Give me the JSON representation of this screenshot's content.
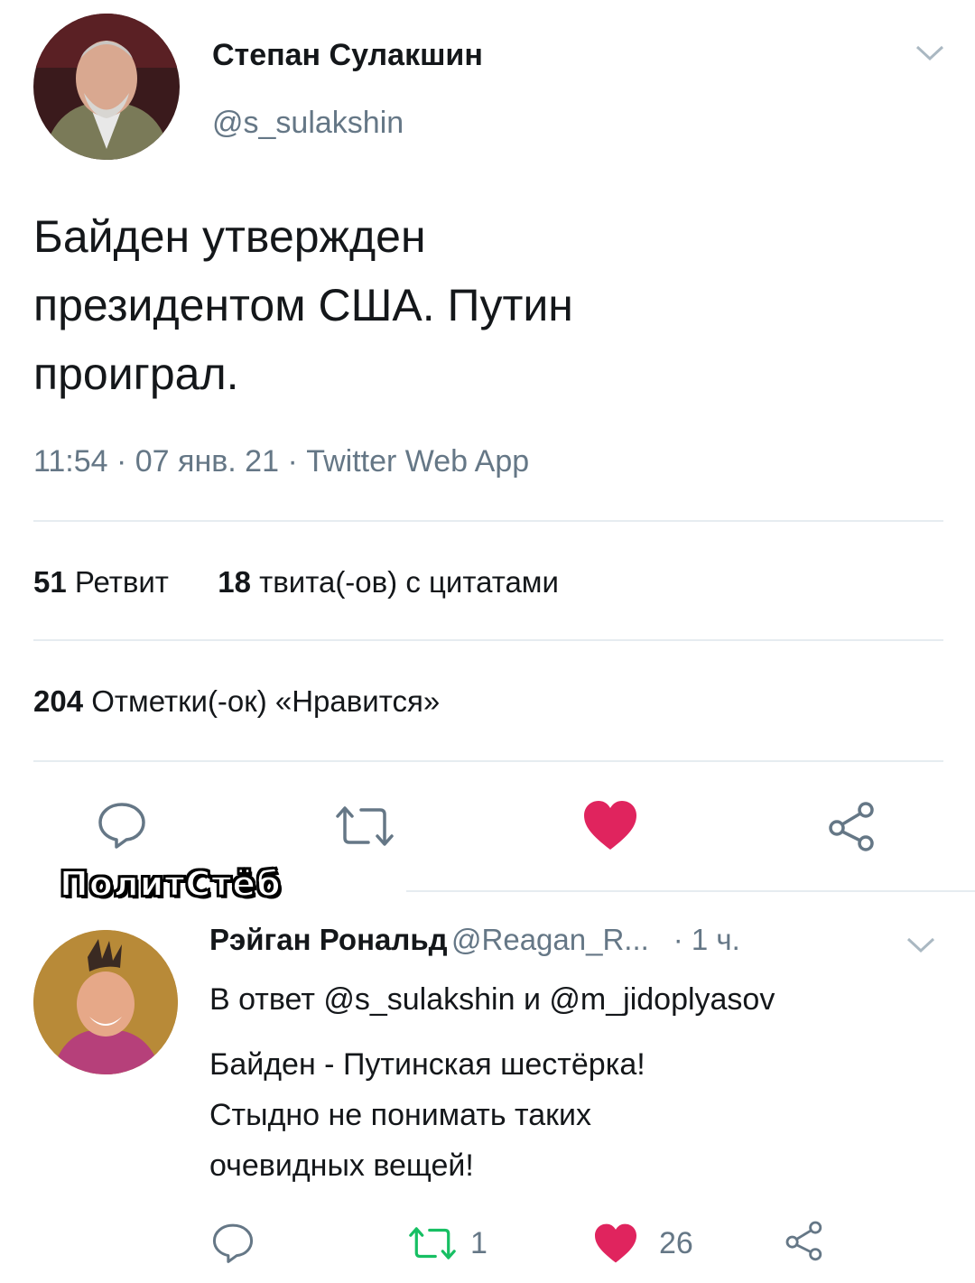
{
  "tweet": {
    "author_name": "Степан Сулакшин",
    "author_handle": "@s_sulakshin",
    "text_line1": "Байден утвержден",
    "text_line2": "президентом США. Путин",
    "text_line3": "проиграл.",
    "meta": "11:54 · 07 янв. 21 · Twitter Web App",
    "retweets_count": "51",
    "retweets_label": "Ретвит",
    "quotes_count": "18",
    "quotes_label": "твита(-ов) с цитатами",
    "likes_count": "204",
    "likes_label": "Отметки(-ок) «Нравится»"
  },
  "watermark": "ПолитСтёб",
  "reply": {
    "author_name": "Рэйган Рональд",
    "author_handle": "@Reagan_R...",
    "time": "· 1 ч.",
    "in_reply_to": "В ответ @s_sulakshin и @m_jidoplyasov",
    "text_line1": "Байден - Путинская шестёрка!",
    "text_line2": "Стыдно не понимать таких",
    "text_line3": "очевидных вещей!",
    "retweet_count": "1",
    "like_count": "26"
  },
  "colors": {
    "like_red": "#e0245e",
    "retweet_green": "#17bf63",
    "muted": "#657786"
  },
  "icons": [
    "reply-icon",
    "retweet-icon",
    "heart-icon",
    "share-icon",
    "chevron-down-icon"
  ]
}
